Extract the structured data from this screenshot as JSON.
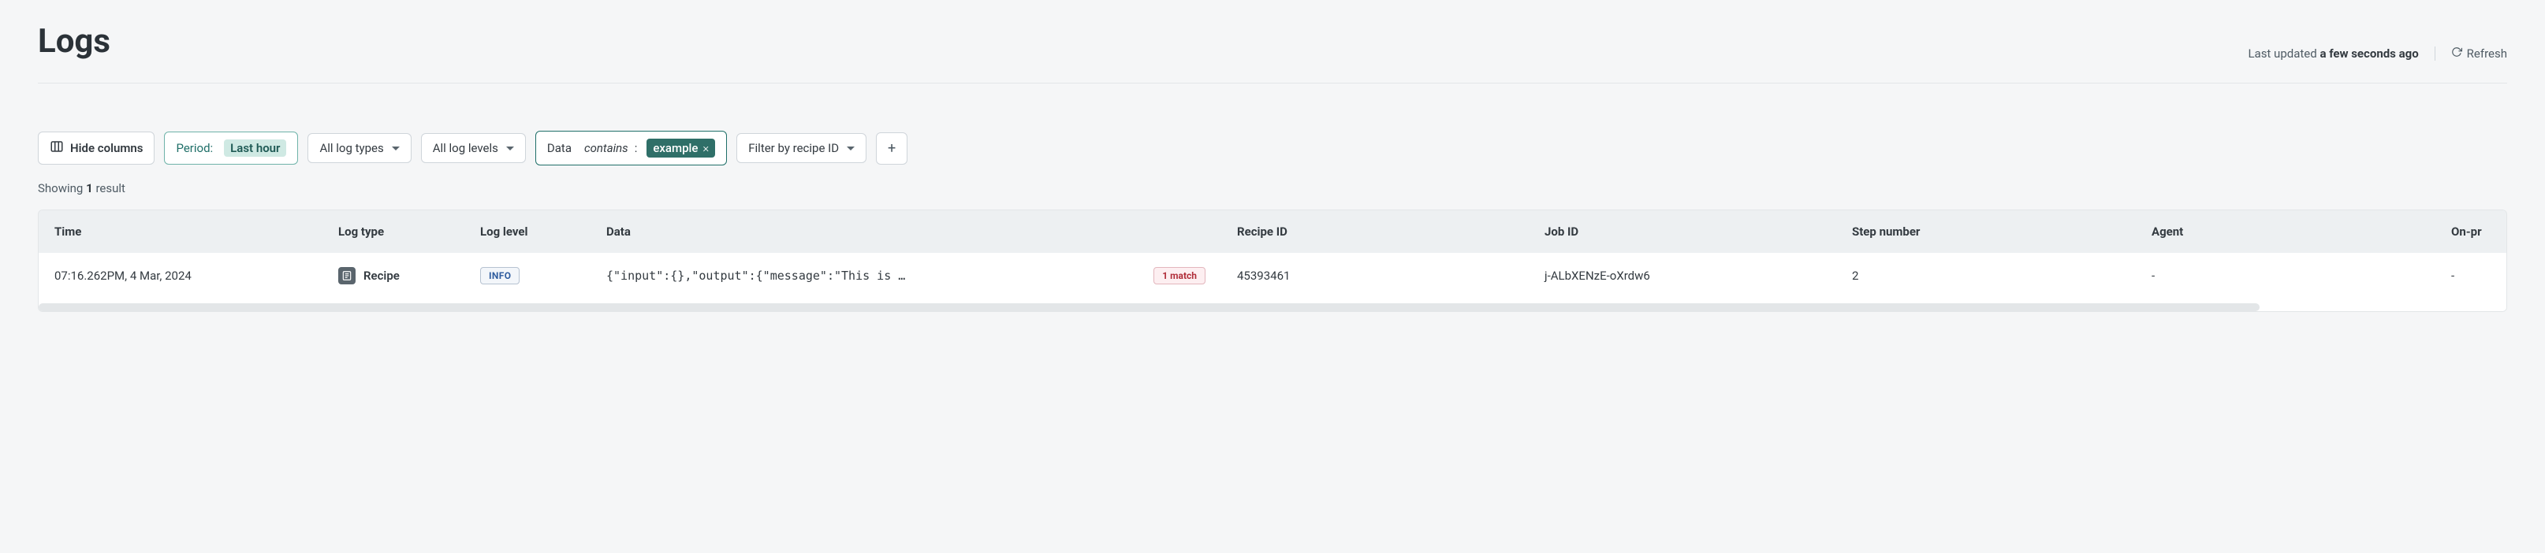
{
  "header": {
    "title": "Logs",
    "last_updated_label": "Last updated",
    "last_updated_value": "a few seconds ago",
    "refresh_label": "Refresh"
  },
  "filters": {
    "hide_columns_label": "Hide columns",
    "period_label": "Period:",
    "period_value": "Last hour",
    "log_types_label": "All log types",
    "log_levels_label": "All log levels",
    "data_label": "Data",
    "data_operator": "contains",
    "data_colon": ":",
    "data_chip_value": "example",
    "recipe_filter_label": "Filter by recipe ID"
  },
  "result_count": {
    "prefix": "Showing",
    "count": "1",
    "suffix": "result"
  },
  "table": {
    "headers": {
      "time": "Time",
      "log_type": "Log type",
      "log_level": "Log level",
      "data": "Data",
      "recipe_id": "Recipe ID",
      "job_id": "Job ID",
      "step_number": "Step number",
      "agent": "Agent",
      "on_prem": "On-pr"
    },
    "rows": [
      {
        "time": "07:16.262PM, 4 Mar, 2024",
        "log_type": "Recipe",
        "log_level": "INFO",
        "data_code": "{\"input\":{},\"output\":{\"message\":\"This is …",
        "match_badge": "1 match",
        "recipe_id": "45393461",
        "job_id": "j-ALbXENzE-oXrdw6",
        "step_number": "2",
        "agent": "-",
        "on_prem": "-"
      }
    ]
  }
}
